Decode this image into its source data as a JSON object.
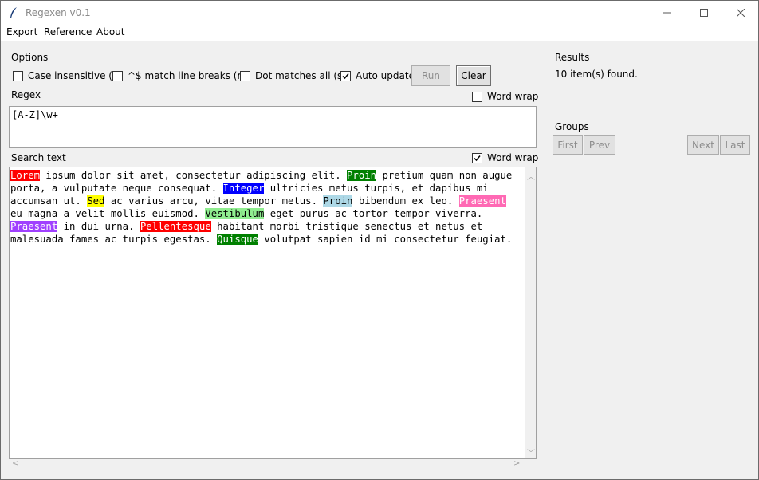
{
  "window": {
    "title": "Regexen v0.1",
    "controls": {
      "minimize_icon": "minimize-icon",
      "maximize_icon": "maximize-icon",
      "close_icon": "close-icon"
    }
  },
  "menu": [
    "Export",
    "Reference",
    "About"
  ],
  "options": {
    "heading": "Options",
    "case_insensitive": {
      "label": "Case insensitive (i)",
      "checked": false
    },
    "multiline": {
      "label": "^$ match line breaks (m)",
      "checked": false
    },
    "dotall": {
      "label": "Dot matches all (s)",
      "checked": false
    },
    "auto_update": {
      "label": "Auto update",
      "checked": true
    },
    "run_label": "Run",
    "clear_label": "Clear"
  },
  "regex": {
    "label": "Regex",
    "word_wrap": {
      "label": "Word wrap",
      "checked": false
    },
    "value": "[A-Z]\\w+"
  },
  "search": {
    "label": "Search text",
    "word_wrap": {
      "label": "Word wrap",
      "checked": true
    },
    "segments": [
      {
        "text": "Lorem",
        "bg": "#ff0000",
        "fg": "#ffffff"
      },
      {
        "text": " ipsum dolor sit amet, consectetur adipiscing elit. "
      },
      {
        "text": "Proin",
        "bg": "#008000",
        "fg": "#ffffff"
      },
      {
        "text": " pretium quam non augue porta, a vulputate neque consequat. "
      },
      {
        "text": "Integer",
        "bg": "#0000ff",
        "fg": "#ffffff"
      },
      {
        "text": " ultricies metus turpis, et dapibus mi accumsan ut. "
      },
      {
        "text": "Sed",
        "bg": "#ffff00",
        "fg": "#000000"
      },
      {
        "text": " ac varius arcu, vitae tempor metus. "
      },
      {
        "text": "Proin",
        "bg": "#add8e6",
        "fg": "#000000"
      },
      {
        "text": " bibendum ex leo. "
      },
      {
        "text": "Praesent",
        "bg": "#ff69b4",
        "fg": "#ffffff"
      },
      {
        "text": " eu magna a velit mollis euismod. "
      },
      {
        "text": "Vestibulum",
        "bg": "#90ee90",
        "fg": "#000000"
      },
      {
        "text": " eget purus ac tortor tempor viverra. "
      },
      {
        "text": "Praesent",
        "bg": "#a040ff",
        "fg": "#ffffff"
      },
      {
        "text": " in dui urna. "
      },
      {
        "text": "Pellentesque",
        "bg": "#ff0000",
        "fg": "#ffffff"
      },
      {
        "text": " habitant morbi tristique senectus et netus et malesuada fames ac turpis egestas. "
      },
      {
        "text": "Quisque",
        "bg": "#008000",
        "fg": "#ffffff"
      },
      {
        "text": " volutpat sapien id mi consectetur feugiat."
      }
    ]
  },
  "results": {
    "heading": "Results",
    "summary": "10 item(s) found."
  },
  "groups": {
    "heading": "Groups",
    "first_label": "First",
    "prev_label": "Prev",
    "next_label": "Next",
    "last_label": "Last"
  }
}
